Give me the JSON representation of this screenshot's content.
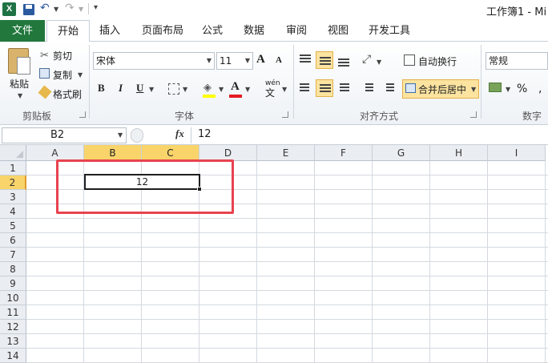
{
  "title_bar": {
    "window_title": "工作簿1 - Mi",
    "app_icon_letter": "X",
    "icons": [
      "excel-app-icon",
      "save-icon",
      "undo-icon",
      "redo-icon",
      "customize-quick-access-icon"
    ]
  },
  "ribbon_tabs": {
    "file": "文件",
    "items": [
      "开始",
      "插入",
      "页面布局",
      "公式",
      "数据",
      "审阅",
      "视图",
      "开发工具"
    ],
    "active": "开始"
  },
  "clipboard": {
    "group_label": "剪贴板",
    "paste": "粘贴",
    "cut": "剪切",
    "copy": "复制",
    "format_painter": "格式刷"
  },
  "font": {
    "group_label": "字体",
    "font_name": "宋体",
    "font_size": "11",
    "bold": "B",
    "italic": "I",
    "underline": "U",
    "font_color_glyph": "A",
    "phonetic": "wén\n文",
    "grow": "A",
    "shrink": "A",
    "fill_color": "#ffff00",
    "font_color": "#e31b23"
  },
  "alignment": {
    "group_label": "对齐方式",
    "wrap_text": "自动换行",
    "merge_center": "合并后居中"
  },
  "number": {
    "group_label": "数字",
    "format": "常规",
    "percent": "%",
    "comma": ","
  },
  "formula_bar": {
    "name_box": "B2",
    "fx": "fx",
    "formula": "12"
  },
  "sheet": {
    "columns": [
      "A",
      "B",
      "C",
      "D",
      "E",
      "F",
      "G",
      "H",
      "I"
    ],
    "rows": [
      "1",
      "2",
      "3",
      "4",
      "5",
      "6",
      "7",
      "8",
      "9",
      "10",
      "11",
      "12",
      "13",
      "14"
    ],
    "selected_columns": [
      "B",
      "C"
    ],
    "selected_row": "2",
    "merged_cell_value": "12",
    "highlight_color": "#e8434f"
  }
}
